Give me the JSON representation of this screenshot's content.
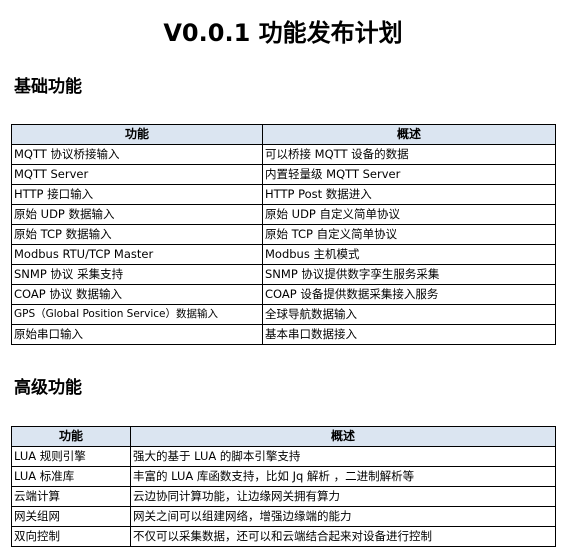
{
  "title": "V0.0.1 功能发布计划",
  "basic": {
    "heading": "基础功能",
    "headers": [
      "功能",
      "概述"
    ],
    "rows": [
      [
        "MQTT 协议桥接输入",
        "可以桥接 MQTT 设备的数据"
      ],
      [
        "MQTT Server",
        "内置轻量级 MQTT Server"
      ],
      [
        "HTTP  接口输入",
        "HTTP Post 数据进入"
      ],
      [
        "原始 UDP  数据输入",
        "原始 UDP 自定义简单协议"
      ],
      [
        "原始 TCP 数据输入",
        "原始 TCP 自定义简单协议"
      ],
      [
        "Modbus RTU/TCP Master",
        "Modbus 主机模式"
      ],
      [
        "SNMP 协议    采集支持",
        "SNMP 协议提供数字孪生服务采集"
      ],
      [
        "COAP 协议  数据输入",
        "COAP 设备提供数据采集接入服务"
      ],
      [
        "GPS（Global Position Service）数据输入",
        "全球导航数据输入"
      ],
      [
        "原始串口输入",
        "基本串口数据接入"
      ]
    ]
  },
  "advanced": {
    "heading": "高级功能",
    "headers": [
      "功能",
      "概述"
    ],
    "rows": [
      [
        "LUA 规则引擎",
        "强大的基于 LUA 的脚本引擎支持"
      ],
      [
        "LUA 标准库",
        "丰富的 LUA 库函数支持，比如 Jq 解析 ，二进制解析等"
      ],
      [
        "云端计算",
        "云边协同计算功能，让边缘网关拥有算力"
      ],
      [
        "网关组网",
        "网关之间可以组建网络，增强边缘端的能力"
      ],
      [
        "双向控制",
        "不仅可以采集数据，还可以和云端结合起来对设备进行控制"
      ]
    ]
  }
}
